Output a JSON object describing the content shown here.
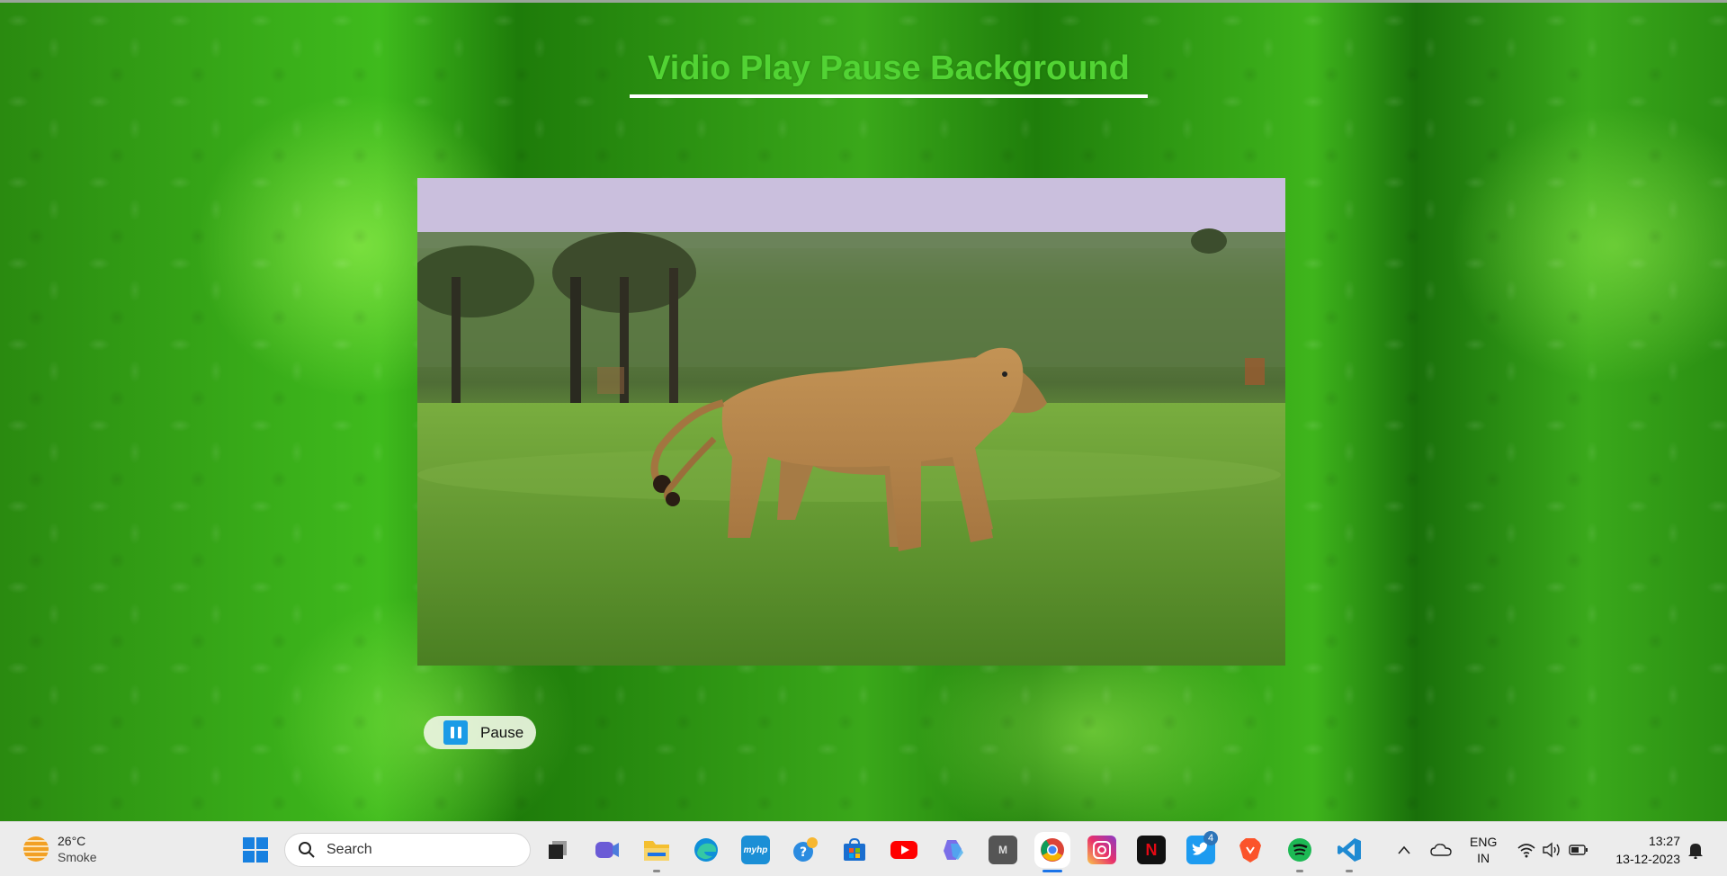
{
  "page": {
    "title": "Vidio Play Pause Background",
    "pause_button_label": "Pause"
  },
  "taskbar": {
    "weather": {
      "temperature": "26°C",
      "condition": "Smoke"
    },
    "search_placeholder": "Search",
    "apps": [
      {
        "name": "task-view-icon"
      },
      {
        "name": "meet-icon"
      },
      {
        "name": "file-explorer-icon"
      },
      {
        "name": "edge-icon"
      },
      {
        "name": "myhp-icon",
        "label": "myhp"
      },
      {
        "name": "get-help-icon"
      },
      {
        "name": "microsoft-store-icon"
      },
      {
        "name": "youtube-icon"
      },
      {
        "name": "copilot-icon"
      },
      {
        "name": "m-app-icon",
        "label": "M"
      },
      {
        "name": "chrome-icon"
      },
      {
        "name": "instagram-icon"
      },
      {
        "name": "netflix-icon",
        "label": "N"
      },
      {
        "name": "twitter-icon",
        "badge": "4"
      },
      {
        "name": "brave-icon"
      },
      {
        "name": "spotify-icon"
      },
      {
        "name": "vscode-icon"
      }
    ],
    "tray": {
      "language_line1": "ENG",
      "language_line2": "IN",
      "time": "13:27",
      "date": "13-12-2023"
    }
  },
  "colors": {
    "title_green": "#52d334",
    "accent_blue": "#1a9be6",
    "taskbar_bg": "#ececec"
  }
}
